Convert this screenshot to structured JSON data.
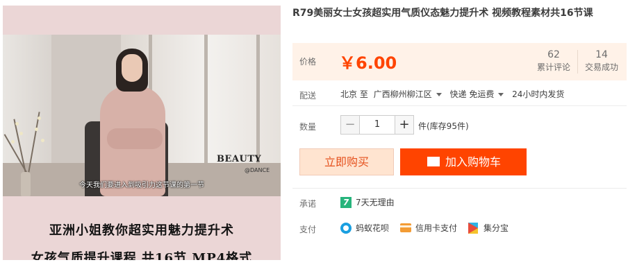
{
  "product": {
    "title": "R79美丽女士女孩超实用气质仪态魅力提升术 视频教程素材共16节课"
  },
  "image": {
    "brand_watermark": "BEAUTY",
    "brand_sub": "@DANCE",
    "subtitle": "今天我们要进入到吸引力这节课的第一节",
    "promo_line1": "亚洲小姐教你超实用魅力提升术",
    "promo_line2": "女孩气质提升课程 共16节 MP4格式"
  },
  "price": {
    "label": "价格",
    "value": "￥6.00",
    "reviews_count": "62",
    "reviews_label": "累计评论",
    "deals_count": "14",
    "deals_label": "交易成功"
  },
  "shipping": {
    "label": "配送",
    "from": "北京 至",
    "to": "广西柳州柳江区",
    "method": "快递 免运费",
    "dispatch": "24小时内发货"
  },
  "quantity": {
    "label": "数量",
    "minus": "−",
    "value": "1",
    "plus": "+",
    "stock": "件(库存95件)"
  },
  "actions": {
    "buy_now": "立即购买",
    "add_to_cart": "加入购物车"
  },
  "promise": {
    "label": "承诺",
    "icon_text": "7",
    "text": "7天无理由"
  },
  "payment": {
    "label": "支付",
    "methods": [
      {
        "icon": "ant-credit-icon",
        "label": "蚂蚁花呗"
      },
      {
        "icon": "credit-card-icon",
        "label": "信用卡支付"
      },
      {
        "icon": "jifenbao-icon",
        "label": "集分宝"
      }
    ]
  },
  "colors": {
    "accent": "#ff4400",
    "price_bg": "#fff2e8",
    "buy_now_bg": "#ffe4d0",
    "promise_green": "#27b47c",
    "image_bg": "#ebd6d6"
  }
}
